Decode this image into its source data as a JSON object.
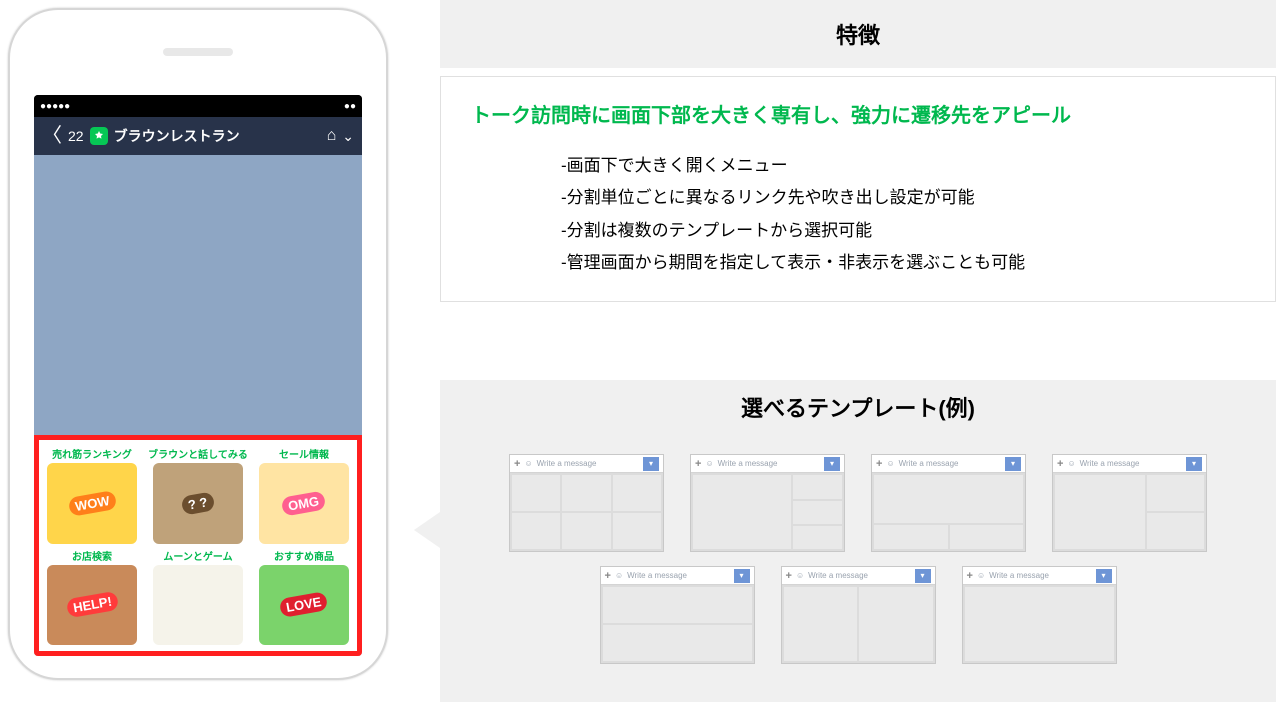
{
  "phone": {
    "back_count": "22",
    "account_name": "ブラウンレストラン",
    "richmenu": [
      {
        "label": "売れ筋ランキング",
        "badge": "WOW",
        "bg": "#ffd54a",
        "badge_bg": "#ff7f1a"
      },
      {
        "label": "ブラウンと話してみる",
        "badge": "? ?",
        "bg": "#bfa27a",
        "badge_bg": "#6b4e2e"
      },
      {
        "label": "セール情報",
        "badge": "OMG",
        "bg": "#ffe4a3",
        "badge_bg": "#ff5f8f"
      },
      {
        "label": "お店検索",
        "badge": "HELP!",
        "bg": "#c98a5a",
        "badge_bg": "#ff3b3b"
      },
      {
        "label": "ムーンとゲーム",
        "badge": "",
        "bg": "#f5f3ea",
        "badge_bg": "#ffffff"
      },
      {
        "label": "おすすめ商品",
        "badge": "LOVE",
        "bg": "#7bd36b",
        "badge_bg": "#e01f2f"
      }
    ]
  },
  "features": {
    "section_title": "特徴",
    "headline": "トーク訪問時に画面下部を大きく専有し、強力に遷移先をアピール",
    "bullets": [
      "-画面下で大きく開くメニュー",
      "-分割単位ごとに異なるリンク先や吹き出し設定が可能",
      "-分割は複数のテンプレートから選択可能",
      "-管理画面から期間を指定して表示・非表示を選ぶことも可能"
    ]
  },
  "templates": {
    "section_title": "選べるテンプレート(例)",
    "msg_placeholder": "Write a message"
  }
}
